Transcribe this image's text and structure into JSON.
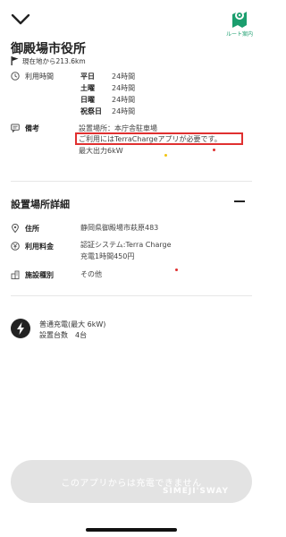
{
  "header": {
    "route_label": "ルート案内"
  },
  "station": {
    "name": "御殿場市役所",
    "distance": "現在地から213.6km"
  },
  "hours": {
    "label": "利用時間",
    "rows": [
      {
        "day": "平日",
        "value": "24時間"
      },
      {
        "day": "土曜",
        "value": "24時間"
      },
      {
        "day": "日曜",
        "value": "24時間"
      },
      {
        "day": "祝祭日",
        "value": "24時間"
      }
    ]
  },
  "notes": {
    "label": "備考",
    "lines": [
      "設置場所：本庁舎駐車場",
      "ご利用にはTerraChargeアプリが必要です。",
      "最大出力6kW"
    ]
  },
  "details": {
    "title": "設置場所詳細",
    "address_label": "住所",
    "address_value": "静岡県御殿場市萩原483",
    "fee_label": "利用料金",
    "fee_lines": [
      "認証システム:Terra Charge",
      "充電1時間450円"
    ],
    "facility_label": "施設種別",
    "facility_value": "その他"
  },
  "charger": {
    "type_line": "普通充電(最大 6kW)",
    "count_line": "設置台数　4台"
  },
  "cta": {
    "label": "このアプリからは充電できません"
  },
  "watermark": "SIMEJI'SWAY",
  "colors": {
    "accent_green": "#1b9e6e",
    "highlight_red": "#e03030",
    "button_disabled": "#e3e3e3"
  }
}
